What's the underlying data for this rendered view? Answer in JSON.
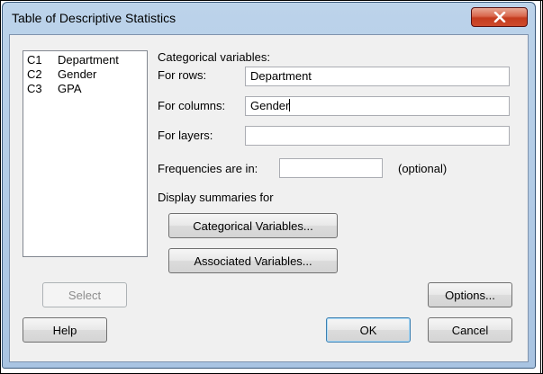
{
  "window": {
    "title": "Table of Descriptive Statistics"
  },
  "variables": [
    {
      "code": "C1",
      "name": "Department"
    },
    {
      "code": "C2",
      "name": "Gender"
    },
    {
      "code": "C3",
      "name": "GPA"
    }
  ],
  "form": {
    "categorical_heading": "Categorical variables:",
    "rows_label": "For rows:",
    "rows_value": "Department",
    "columns_label": "For columns:",
    "columns_value": "Gender",
    "layers_label": "For layers:",
    "layers_value": "",
    "frequencies_label": "Frequencies are in:",
    "frequencies_value": "",
    "optional_label": "(optional)",
    "display_summaries_label": "Display summaries for"
  },
  "buttons": {
    "categorical_variables": "Categorical Variables...",
    "associated_variables": "Associated Variables...",
    "select": "Select",
    "options": "Options...",
    "help": "Help",
    "ok": "OK",
    "cancel": "Cancel"
  }
}
